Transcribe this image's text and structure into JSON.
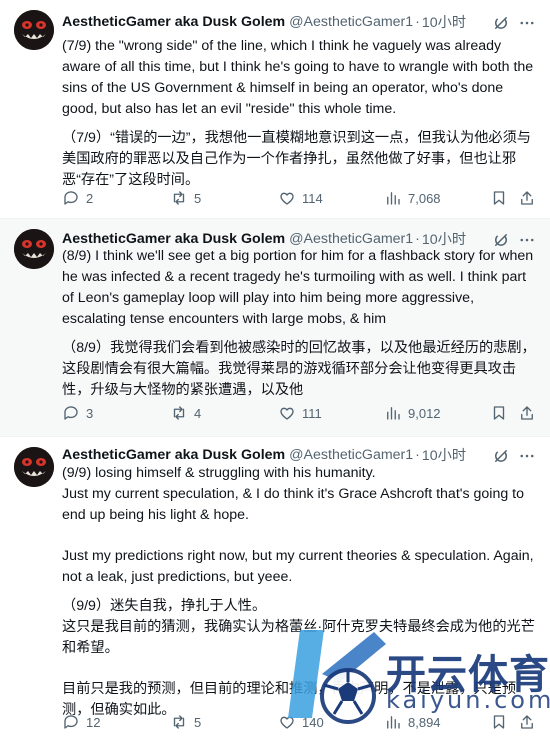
{
  "tweets": [
    {
      "author_name": "AestheticGamer aka Dusk Golem",
      "handle": "@AestheticGamer1",
      "time": "10小时",
      "text": "(7/9) the \"wrong side\" of the line, which I think he vaguely was already aware of all this time, but I think he's going to have to wrangle with both the sins of the US Government & himself in being an operator, who's done good, but also has let an evil \"reside\" this whole time.",
      "translation": "（7/9）“错误的一边”，我想他一直模糊地意识到这一点，但我认为他必须与美国政府的罪恶以及自己作为一个作者挣扎，虽然他做了好事，但也让邪恶“存在”了这段时间。",
      "replies": "2",
      "retweets": "5",
      "likes": "114",
      "views": "7,068"
    },
    {
      "author_name": "AestheticGamer aka Dusk Golem",
      "handle": "@AestheticGamer1",
      "time": "10小时",
      "text": "(8/9) I think we'll see get a big portion for him for a flashback story for when he was infected & a recent tragedy he's turmoiling with as well. I think part of Leon's gameplay loop will play into him being more aggressive, escalating tense encounters with large mobs, & him",
      "translation": "（8/9）我觉得我们会看到他被感染时的回忆故事，以及他最近经历的悲剧，这段剧情会有很大篇幅。我觉得莱昂的游戏循环部分会让他变得更具攻击性，升级与大怪物的紧张遭遇，以及他",
      "replies": "3",
      "retweets": "4",
      "likes": "111",
      "views": "9,012"
    },
    {
      "author_name": "AestheticGamer aka Dusk Golem",
      "handle": "@AestheticGamer1",
      "time": "10小时",
      "text_lines": [
        "(9/9) losing himself & struggling with his humanity.",
        "Just my current speculation, & I do think it's Grace Ashcroft that's going to end up being his light & hope.",
        "Just my predictions right now, but my current theories & speculation. Again, not a leak, just predictions, but yeee."
      ],
      "translation_lines": [
        "（9/9）迷失自我，挣扎于人性。",
        "这只是我目前的猜测，我确实认为格蕾丝·阿什克罗夫特最终会成为他的光芒和希望。",
        "目前只是我的预测，但目前的理论和推测，再次声明，不是泄露，只是预测，但确实如此。"
      ],
      "replies": "12",
      "retweets": "5",
      "likes": "140",
      "views": "8,894"
    }
  ],
  "watermark": {
    "cn": "开云体育",
    "en": "kaiyun.com"
  },
  "colors": {
    "text": "#0f1419",
    "muted": "#536471",
    "divider": "#eff3f4",
    "watermark": "#1a3a7a"
  },
  "icons": [
    "avatar-monster-icon",
    "grok-icon",
    "more-icon",
    "reply-icon",
    "retweet-icon",
    "like-icon",
    "views-icon",
    "bookmark-icon",
    "share-icon"
  ]
}
